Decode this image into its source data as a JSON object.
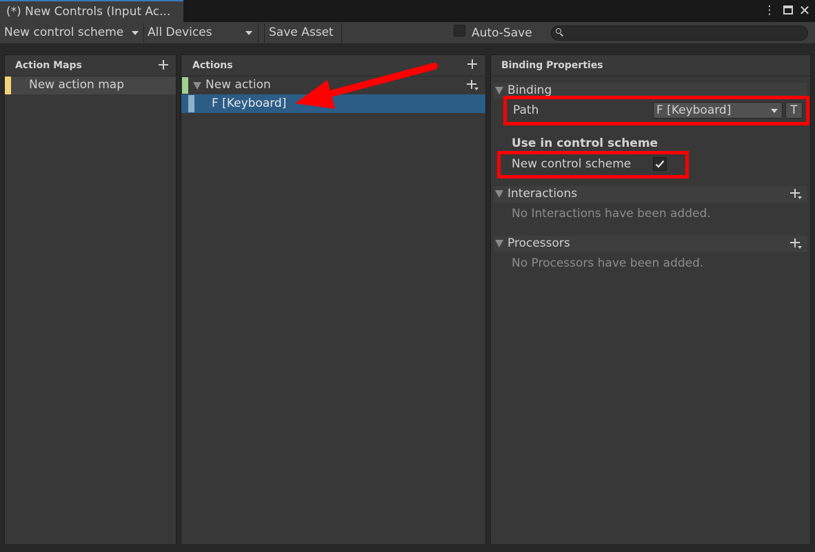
{
  "window": {
    "tab_title": "(*) New Controls (Input Ac...",
    "icons": [
      "more-vert-icon",
      "maximize-icon",
      "close-icon"
    ]
  },
  "toolbar": {
    "control_scheme": "New control scheme",
    "devices": "All Devices",
    "save_asset": "Save Asset",
    "auto_save": "Auto-Save",
    "auto_save_checked": false,
    "search_value": ""
  },
  "action_maps": {
    "title": "Action Maps",
    "items": [
      {
        "label": "New action map",
        "color": "#f3d379"
      }
    ]
  },
  "actions": {
    "title": "Actions",
    "items": [
      {
        "label": "New action",
        "color": "#9ed18c"
      },
      {
        "label": "F [Keyboard]",
        "color": "#8ab4c8",
        "selected": true
      }
    ]
  },
  "binding": {
    "title": "Binding Properties",
    "binding_section": "Binding",
    "path_label": "Path",
    "path_value": "F [Keyboard]",
    "t_button": "T",
    "use_in_scheme_label": "Use in control scheme",
    "scheme_name": "New control scheme",
    "scheme_checked": true,
    "interactions_section": "Interactions",
    "interactions_empty": "No Interactions have been added.",
    "processors_section": "Processors",
    "processors_empty": "No Processors have been added."
  },
  "colors": {
    "selection": "#2c5d87",
    "annotation_red": "#ff0000",
    "tab_accent": "#3a79bb"
  }
}
